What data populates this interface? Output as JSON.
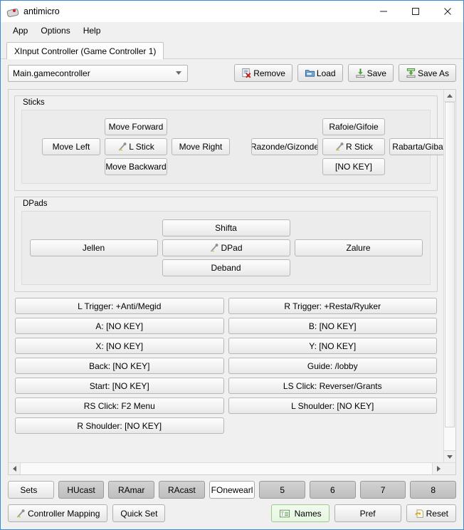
{
  "window": {
    "title": "antimicro",
    "icon": "gamepad-icon",
    "controls": {
      "minimize": "minimize-icon",
      "maximize": "maximize-icon",
      "close": "close-icon"
    }
  },
  "menubar": {
    "items": [
      "App",
      "Options",
      "Help"
    ]
  },
  "tabs": [
    {
      "label": "XInput Controller (Game Controller 1)",
      "active": true
    }
  ],
  "profile": {
    "selected": "Main.gamecontroller",
    "dropdown_icon": "chevron-down-icon"
  },
  "toolbar": {
    "remove_label": "Remove",
    "load_label": "Load",
    "save_label": "Save",
    "save_as_label": "Save As"
  },
  "sticks": {
    "title": "Sticks",
    "left": {
      "up": "Move Forward",
      "left": "Move Left",
      "center": "L Stick",
      "right": "Move Right",
      "down": "Move Backward"
    },
    "right": {
      "up": "Rafoie/Gifoie",
      "left": "Razonde/Gizonde",
      "center": "R Stick",
      "right": "Rabarta/Gibarta",
      "down": "[NO KEY]"
    }
  },
  "dpads": {
    "title": "DPads",
    "up": "Shifta",
    "left": "Jellen",
    "center": "DPad",
    "right": "Zalure",
    "down": "Deband"
  },
  "buttons": [
    "L Trigger: +Anti/Megid",
    "R Trigger: +Resta/Ryuker",
    "A: [NO KEY]",
    "B: [NO KEY]",
    "X: [NO KEY]",
    "Y: [NO KEY]",
    "Back: [NO KEY]",
    "Guide: /lobby",
    "Start: [NO KEY]",
    "LS Click: Reverser/Grants",
    "RS Click: F2 Menu",
    "L Shoulder: [NO KEY]",
    "R Shoulder: [NO KEY]"
  ],
  "sets": {
    "menu_label": "Sets",
    "items": [
      {
        "label": "HUcast",
        "active": false
      },
      {
        "label": "RAmar",
        "active": false
      },
      {
        "label": "RAcast",
        "active": false
      },
      {
        "label": "FOnewearl",
        "active": true
      },
      {
        "label": "5",
        "active": false
      },
      {
        "label": "6",
        "active": false
      },
      {
        "label": "7",
        "active": false
      },
      {
        "label": "8",
        "active": false
      }
    ]
  },
  "actions": {
    "controller_mapping": "Controller Mapping",
    "quick_set": "Quick Set",
    "names": "Names",
    "pref": "Pref",
    "reset": "Reset"
  },
  "colors": {
    "window_border": "#3b8bd4",
    "window_bg": "#f0f0f0",
    "active_set_bg": "#ffffff",
    "inactive_set_bg": "#c6c6c6",
    "names_active_bg": "#e6f6e0",
    "names_active_border": "#9ec98c"
  }
}
